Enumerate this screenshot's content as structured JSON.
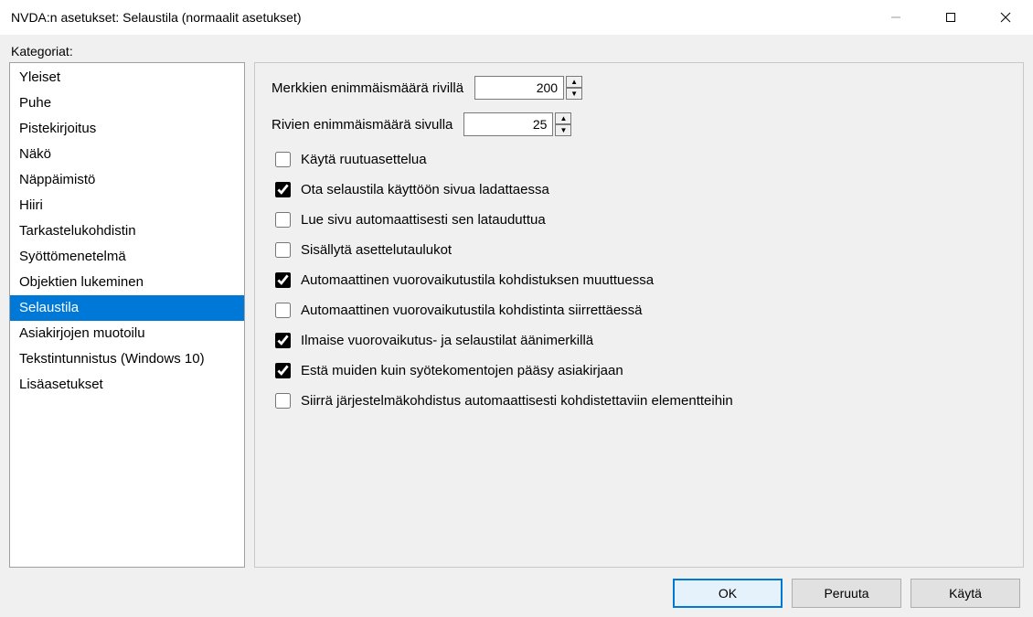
{
  "window": {
    "title": "NVDA:n asetukset: Selaustila (normaalit asetukset)"
  },
  "categories_label": "Kategoriat:",
  "categories": [
    "Yleiset",
    "Puhe",
    "Pistekirjoitus",
    "Näkö",
    "Näppäimistö",
    "Hiiri",
    "Tarkastelukohdistin",
    "Syöttömenetelmä",
    "Objektien lukeminen",
    "Selaustila",
    "Asiakirjojen muotoilu",
    "Tekstintunnistus (Windows 10)",
    "Lisäasetukset"
  ],
  "selected_index": 9,
  "spinners": {
    "max_chars_label": "Merkkien enimmäismäärä rivillä",
    "max_chars_value": "200",
    "max_rows_label": "Rivien enimmäismäärä sivulla",
    "max_rows_value": "25"
  },
  "checkboxes": [
    {
      "label": "Käytä ruutuasettelua",
      "checked": false
    },
    {
      "label": "Ota selaustila käyttöön sivua ladattaessa",
      "checked": true
    },
    {
      "label": "Lue sivu automaattisesti sen latauduttua",
      "checked": false
    },
    {
      "label": "Sisällytä asettelutaulukot",
      "checked": false
    },
    {
      "label": "Automaattinen vuorovaikutustila kohdistuksen muuttuessa",
      "checked": true
    },
    {
      "label": "Automaattinen vuorovaikutustila kohdistinta siirrettäessä",
      "checked": false
    },
    {
      "label": "Ilmaise vuorovaikutus- ja selaustilat äänimerkillä",
      "checked": true
    },
    {
      "label": "Estä muiden kuin syötekomentojen pääsy asiakirjaan",
      "checked": true
    },
    {
      "label": "Siirrä järjestelmäkohdistus automaattisesti kohdistettaviin elementteihin",
      "checked": false
    }
  ],
  "buttons": {
    "ok": "OK",
    "cancel": "Peruuta",
    "apply": "Käytä"
  }
}
